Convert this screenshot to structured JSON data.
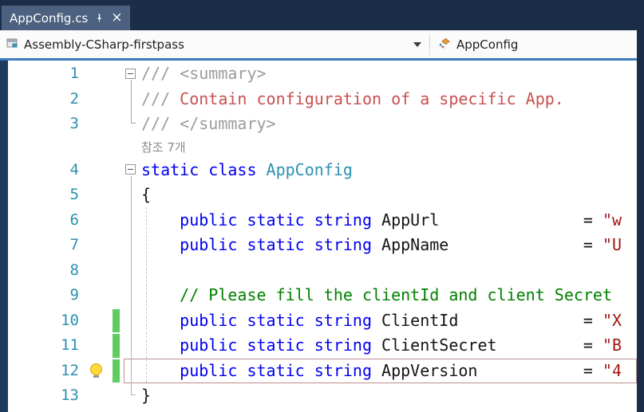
{
  "tab_bar": {
    "tabs": [
      {
        "title": "AppConfig.cs",
        "active": true
      }
    ],
    "close_glyph": "×"
  },
  "navbar": {
    "project": "Assembly-CSharp-firstpass",
    "member": "AppConfig"
  },
  "editor": {
    "codelens_text": "참조 7개",
    "colors": {
      "keyword": "#0000F0",
      "type": "#2B91AF",
      "comment": "#008000",
      "doc_comment": "#9B9B9B",
      "doc_text": "#C75050",
      "string": "#A31515",
      "line_number": "#2B91AF",
      "change_bar": "#5ECC5E",
      "accent_line": "#3D7CC0"
    },
    "lines": [
      {
        "num": "1",
        "fold": true,
        "segments": [
          {
            "style": "doc",
            "text": "/// <summary>"
          }
        ]
      },
      {
        "num": "2",
        "segments": [
          {
            "style": "doc",
            "text": "/// "
          },
          {
            "style": "docred",
            "text": "Contain configuration of a specific App."
          }
        ]
      },
      {
        "num": "3",
        "segments": [
          {
            "style": "doc",
            "text": "/// </summary>"
          }
        ]
      },
      {
        "codelens": true
      },
      {
        "num": "4",
        "fold": true,
        "segments": [
          {
            "style": "kw",
            "text": "static class "
          },
          {
            "style": "type",
            "text": "AppConfig"
          }
        ]
      },
      {
        "num": "5",
        "segments": [
          {
            "style": "pln",
            "text": "{"
          }
        ]
      },
      {
        "num": "6",
        "segments": [
          {
            "style": "pln",
            "text": "    "
          },
          {
            "style": "kw",
            "text": "public static string "
          },
          {
            "style": "pln",
            "text": "AppUrl               = "
          },
          {
            "style": "str",
            "text": "\"w"
          }
        ]
      },
      {
        "num": "7",
        "segments": [
          {
            "style": "pln",
            "text": "    "
          },
          {
            "style": "kw",
            "text": "public static string "
          },
          {
            "style": "pln",
            "text": "AppName              = "
          },
          {
            "style": "str",
            "text": "\"U"
          }
        ]
      },
      {
        "num": "8",
        "segments": []
      },
      {
        "num": "9",
        "segments": [
          {
            "style": "pln",
            "text": "    "
          },
          {
            "style": "cmt",
            "text": "// Please fill the clientId and client Secret"
          }
        ]
      },
      {
        "num": "10",
        "changed": true,
        "segments": [
          {
            "style": "pln",
            "text": "    "
          },
          {
            "style": "kw",
            "text": "public static string "
          },
          {
            "style": "pln",
            "text": "ClientId             = "
          },
          {
            "style": "str",
            "text": "\"X"
          }
        ]
      },
      {
        "num": "11",
        "changed": true,
        "segments": [
          {
            "style": "pln",
            "text": "    "
          },
          {
            "style": "kw",
            "text": "public static string "
          },
          {
            "style": "pln",
            "text": "ClientSecret         = "
          },
          {
            "style": "str",
            "text": "\"B"
          }
        ]
      },
      {
        "num": "12",
        "changed": true,
        "current": true,
        "bulb": true,
        "segments": [
          {
            "style": "pln",
            "text": "    "
          },
          {
            "style": "kw",
            "text": "public static string "
          },
          {
            "style": "pln",
            "text": "AppVersion           = "
          },
          {
            "style": "str",
            "text": "\"4"
          }
        ]
      },
      {
        "num": "13",
        "segments": [
          {
            "style": "pln",
            "text": "}"
          }
        ]
      }
    ]
  }
}
